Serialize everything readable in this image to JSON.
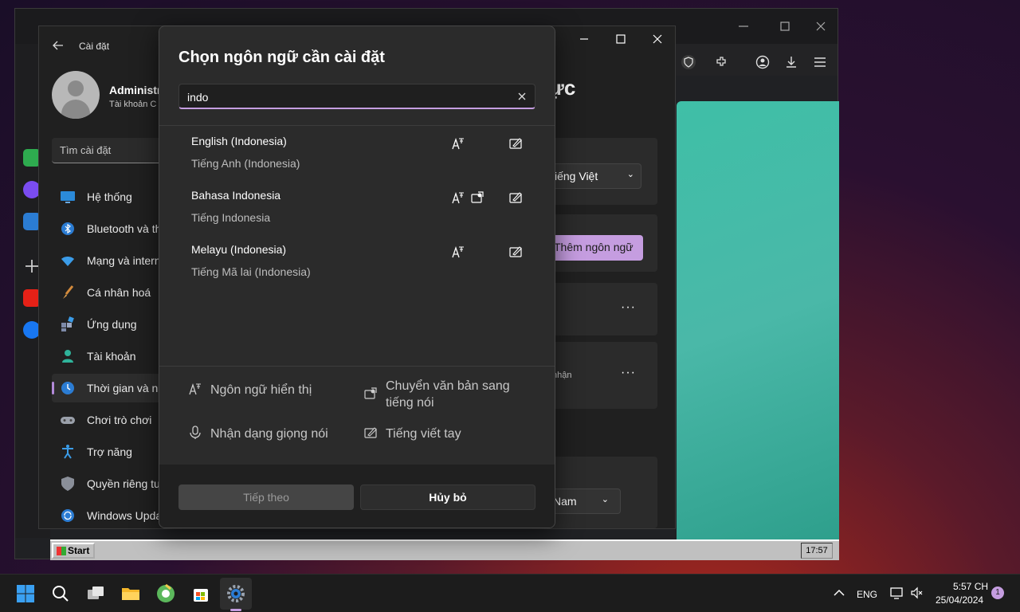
{
  "settings": {
    "title": "Cài đặt",
    "user_name": "Administra",
    "user_type": "Tài khoản C",
    "search_placeholder": "Tìm cài đặt",
    "nav": [
      {
        "label": "Hệ thống",
        "icon": "monitor-icon"
      },
      {
        "label": "Bluetooth và th",
        "icon": "bluetooth-icon"
      },
      {
        "label": "Mạng và intern",
        "icon": "wifi-icon"
      },
      {
        "label": "Cá nhân hoá",
        "icon": "brush-icon"
      },
      {
        "label": "Ứng dụng",
        "icon": "apps-icon"
      },
      {
        "label": "Tài khoản",
        "icon": "person-icon"
      },
      {
        "label": "Thời gian và ng",
        "icon": "clock-globe-icon"
      },
      {
        "label": "Chơi trò chơi",
        "icon": "gamepad-icon"
      },
      {
        "label": "Trợ năng",
        "icon": "accessibility-icon"
      },
      {
        "label": "Quyền riêng tư",
        "icon": "shield-icon"
      },
      {
        "label": "Windows Upda",
        "icon": "update-icon"
      }
    ],
    "heading_fragment": "ực",
    "display_language": "iếng Việt",
    "add_language": "Thêm ngôn ngữ",
    "recognition_fragment": "nhận",
    "region_value": "Nam"
  },
  "dialog": {
    "title": "Chọn ngôn ngữ cần cài đặt",
    "search_value": "indo",
    "languages": [
      {
        "name": "English (Indonesia)",
        "native": "Tiếng Anh (Indonesia)",
        "features": [
          "display-language-icon",
          "handwriting-icon"
        ]
      },
      {
        "name": "Bahasa Indonesia",
        "native": "Tiếng Indonesia",
        "features": [
          "display-language-icon",
          "text-to-speech-icon",
          "handwriting-icon"
        ]
      },
      {
        "name": "Melayu (Indonesia)",
        "native": "Tiếng Mã lai (Indonesia)",
        "features": [
          "display-language-icon",
          "handwriting-icon"
        ]
      }
    ],
    "legend": {
      "display": "Ngôn ngữ hiển thị",
      "tts": "Chuyển văn bản sang tiếng nói",
      "speech": "Nhận dạng giọng nói",
      "handwriting": "Tiếng viết tay"
    },
    "next_button": "Tiếp theo",
    "cancel_button": "Hủy bỏ"
  },
  "retro": {
    "start_label": "Start",
    "clock": "17:57"
  },
  "taskbar": {
    "lang": "ENG",
    "time": "5:57 CH",
    "date": "25/04/2024",
    "notification_count": "1"
  },
  "colors": {
    "accent": "#c59de0",
    "dialog_bg": "#2b2b2b",
    "window_bg": "#202020",
    "teal_panel": "#3fbfa7"
  }
}
